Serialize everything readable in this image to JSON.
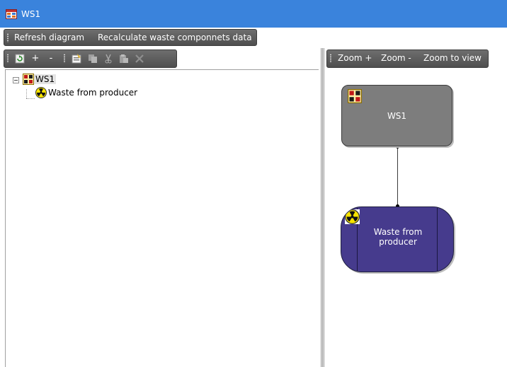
{
  "window": {
    "title": "WS1",
    "icon": "app-window-icon",
    "title_bar_color": "#3a83dc"
  },
  "main_toolbar": {
    "refresh_label": "Refresh diagram",
    "recalc_label": "Recalculate waste componnets data"
  },
  "tree_toolbar": {
    "items": [
      {
        "name": "refresh-tree-icon",
        "glyph": ""
      },
      {
        "name": "expand-button",
        "glyph": "+"
      },
      {
        "name": "collapse-button",
        "glyph": "-"
      },
      {
        "name": "properties-icon",
        "glyph": ""
      },
      {
        "name": "copy-icon",
        "glyph": ""
      },
      {
        "name": "cut-icon",
        "glyph": ""
      },
      {
        "name": "paste-icon",
        "glyph": ""
      },
      {
        "name": "delete-icon",
        "glyph": ""
      }
    ]
  },
  "tree": {
    "root": {
      "label": "WS1",
      "icon": "waste-site-icon",
      "expanded": true
    },
    "children": [
      {
        "label": "Waste from producer",
        "icon": "radioactive-icon"
      }
    ]
  },
  "diagram_toolbar": {
    "zoom_in_label": "Zoom +",
    "zoom_out_label": "Zoom -",
    "zoom_view_label": "Zoom to view"
  },
  "diagram": {
    "ws1_node": {
      "label": "WS1",
      "icon": "waste-site-icon",
      "color": "#7d7d7d"
    },
    "waste_node": {
      "label": "Waste from producer",
      "icon": "radioactive-icon",
      "color": "#463b8d"
    }
  }
}
